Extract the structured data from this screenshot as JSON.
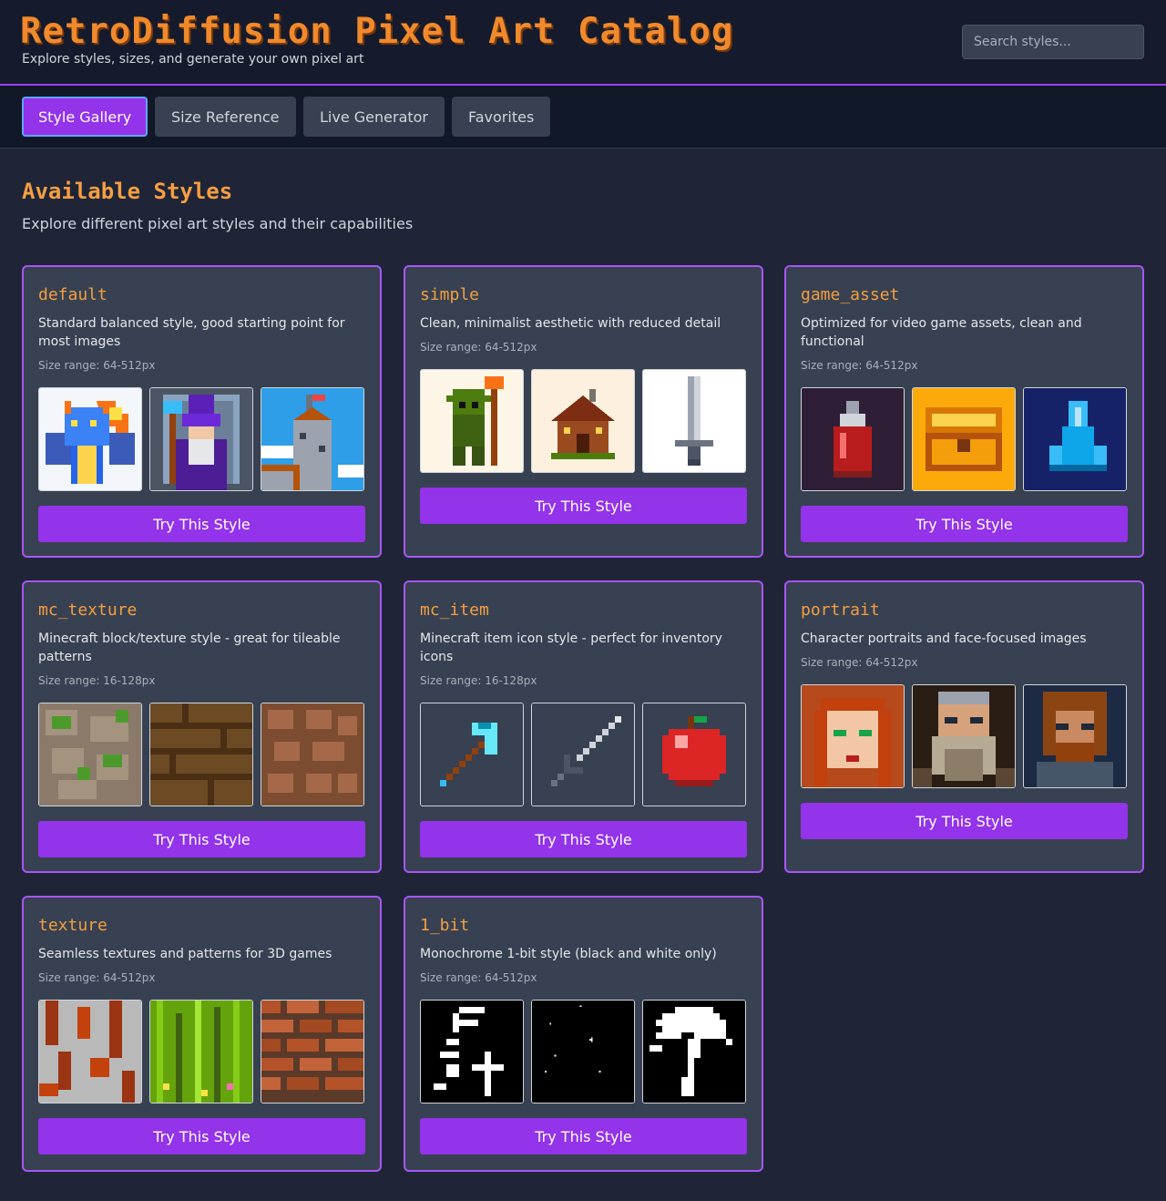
{
  "header": {
    "title": "RetroDiffusion Pixel Art Catalog",
    "subtitle": "Explore styles, sizes, and generate your own pixel art",
    "search_placeholder": "Search styles..."
  },
  "tabs": [
    {
      "label": "Style Gallery",
      "active": true
    },
    {
      "label": "Size Reference",
      "active": false
    },
    {
      "label": "Live Generator",
      "active": false
    },
    {
      "label": "Favorites",
      "active": false
    }
  ],
  "section": {
    "title": "Available Styles",
    "subtitle": "Explore different pixel art styles and their capabilities"
  },
  "try_label": "Try This Style",
  "colors": {
    "accent": "#9333ea",
    "accent_border": "#a855f7",
    "title_orange": "#f59e42",
    "card_bg": "#374151"
  },
  "styles": [
    {
      "name": "default",
      "description": "Standard balanced style, good starting point for most images",
      "size_range": "Size range: 64-512px",
      "images": [
        "blue dragon breathing fire",
        "wizard with staff",
        "castle tower with flag"
      ]
    },
    {
      "name": "simple",
      "description": "Clean, minimalist aesthetic with reduced detail",
      "size_range": "Size range: 64-512px",
      "images": [
        "green goblin with spear",
        "wooden cabin",
        "sword"
      ]
    },
    {
      "name": "game_asset",
      "description": "Optimized for video game assets, clean and functional",
      "size_range": "Size range: 64-512px",
      "images": [
        "red potion bottle",
        "golden treasure chest",
        "blue crystal"
      ]
    },
    {
      "name": "mc_texture",
      "description": "Minecraft block/texture style - great for tileable patterns",
      "size_range": "Size range: 16-128px",
      "images": [
        "mossy cobblestone",
        "wooden planks",
        "dirt cobble"
      ]
    },
    {
      "name": "mc_item",
      "description": "Minecraft item icon style - perfect for inventory icons",
      "size_range": "Size range: 16-128px",
      "images": [
        "diamond pickaxe",
        "iron sword",
        "red apple"
      ]
    },
    {
      "name": "portrait",
      "description": "Character portraits and face-focused images",
      "size_range": "Size range: 64-512px",
      "images": [
        "red-haired elf woman",
        "bearded dwarf",
        "bearded warrior"
      ]
    },
    {
      "name": "texture",
      "description": "Seamless textures and patterns for 3D games",
      "size_range": "Size range: 64-512px",
      "images": [
        "rusted metal",
        "grass",
        "brick wall"
      ]
    },
    {
      "name": "1_bit",
      "description": "Monochrome 1-bit style (black and white only)",
      "size_range": "Size range: 64-512px",
      "images": [
        "knight with sword",
        "starry sky",
        "tree"
      ]
    }
  ]
}
